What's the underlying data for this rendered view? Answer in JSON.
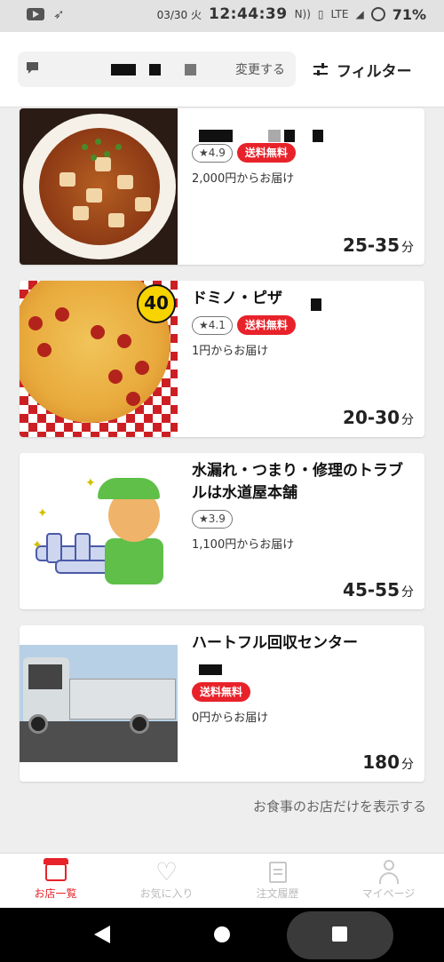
{
  "status_bar": {
    "date": "03/30 火",
    "time": "12:44:39",
    "network": "LTE",
    "battery": "71%"
  },
  "header": {
    "change_label": "変更する",
    "filter_label": "フィルター"
  },
  "shops": [
    {
      "name": "",
      "rating": "★4.9",
      "free_delivery": "送料無料",
      "min_order": "2,000円からお届け",
      "time": "25-35",
      "time_unit": "分"
    },
    {
      "name": "ドミノ・ピザ",
      "rating": "★4.1",
      "free_delivery": "送料無料",
      "min_order": "1円からお届け",
      "time": "20-30",
      "time_unit": "分",
      "thumb_badge": "40"
    },
    {
      "name": "水漏れ・つまり・修理のトラブルは水道屋本舗",
      "rating": "★3.9",
      "min_order": "1,100円からお届け",
      "time": "45-55",
      "time_unit": "分"
    },
    {
      "name": "ハートフル回収センター",
      "free_delivery": "送料無料",
      "min_order": "0円からお届け",
      "time": "180",
      "time_unit": "分"
    }
  ],
  "show_only_food": "お食事のお店だけを表示する",
  "bottom_nav": [
    {
      "label": "お店一覧",
      "icon": "store-icon",
      "active": true
    },
    {
      "label": "お気に入り",
      "icon": "heart-icon",
      "active": false
    },
    {
      "label": "注文履歴",
      "icon": "receipt-icon",
      "active": false
    },
    {
      "label": "マイページ",
      "icon": "user-icon",
      "active": false
    }
  ],
  "colors": {
    "accent": "#e8222a",
    "background": "#eeeeee",
    "inactive_nav": "#bbbbbb"
  }
}
